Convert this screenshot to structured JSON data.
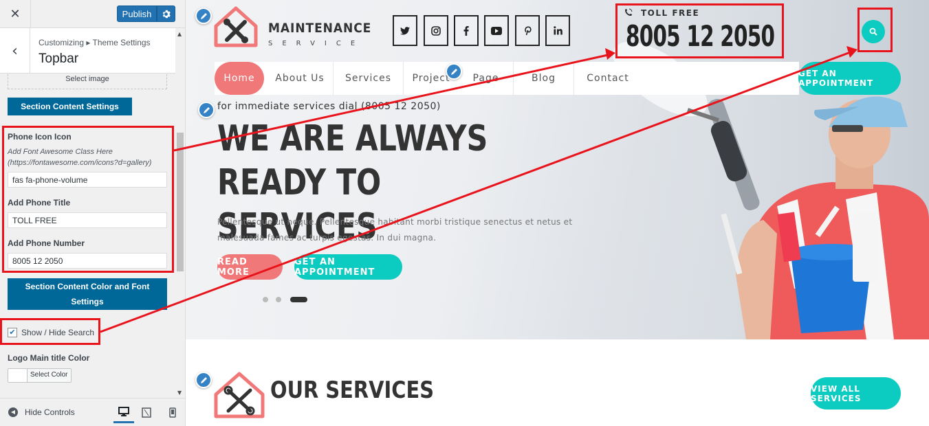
{
  "customizer": {
    "close_icon": "close-icon",
    "publish_label": "Publish",
    "breadcrumb": "Customizing ▸ Theme Settings",
    "section_title": "Topbar",
    "select_image_label": "Select image",
    "section_content_settings_label": "Section Content Settings",
    "phone_icon_label": "Phone Icon Icon",
    "phone_icon_desc": "Add Font Awesome Class Here (https://fontawesome.com/icons?d=gallery)",
    "phone_icon_value": "fas fa-phone-volume",
    "phone_title_label": "Add Phone Title",
    "phone_title_value": "TOLL FREE",
    "phone_number_label": "Add Phone Number",
    "phone_number_value": "8005 12 2050",
    "color_font_settings_label": "Section Content Color and Font Settings",
    "show_hide_search_label": "Show / Hide Search",
    "show_hide_search_checked": true,
    "logo_color_label": "Logo Main title Color",
    "select_color_label": "Select Color",
    "hide_controls_label": "Hide Controls"
  },
  "site": {
    "logo_main": "MAINTENANCE",
    "logo_sub": "SERVICE",
    "social": [
      {
        "icon": "twitter-icon",
        "glyph": "🐦"
      },
      {
        "icon": "instagram-icon",
        "glyph": "◎"
      },
      {
        "icon": "facebook-icon",
        "glyph": "f"
      },
      {
        "icon": "youtube-icon",
        "glyph": "▶"
      },
      {
        "icon": "pinterest-icon",
        "glyph": "P"
      },
      {
        "icon": "linkedin-icon",
        "glyph": "in"
      }
    ],
    "phone_title": "TOLL FREE",
    "phone_number": "8005 12 2050",
    "nav": [
      "Home",
      "About Us",
      "Services",
      "Project",
      "Page",
      "Blog",
      "Contact"
    ],
    "appointment_label": "GET AN APPOINTMENT",
    "hero_tagline": "for immediate services dial (8005 12 2050)",
    "hero_heading": "WE ARE ALWAYS READY TO SERVICES",
    "hero_text": "Pellentesque ut neque. Pellentesque habitant morbi tristique senectus et netus et malesuada fames ac turpis egestas. In dui magna.",
    "read_more_label": "READ MORE",
    "hero_appointment_label": "GET AN APPOINTMENT",
    "services_title": "OUR SERVICES",
    "view_all_label": "VIEW ALL SERVICES"
  },
  "colors": {
    "accent_teal": "#0ccbc0",
    "accent_coral": "#f07878",
    "wp_blue": "#2271b1",
    "section_button": "#006799",
    "highlight_red": "#e8131b"
  }
}
